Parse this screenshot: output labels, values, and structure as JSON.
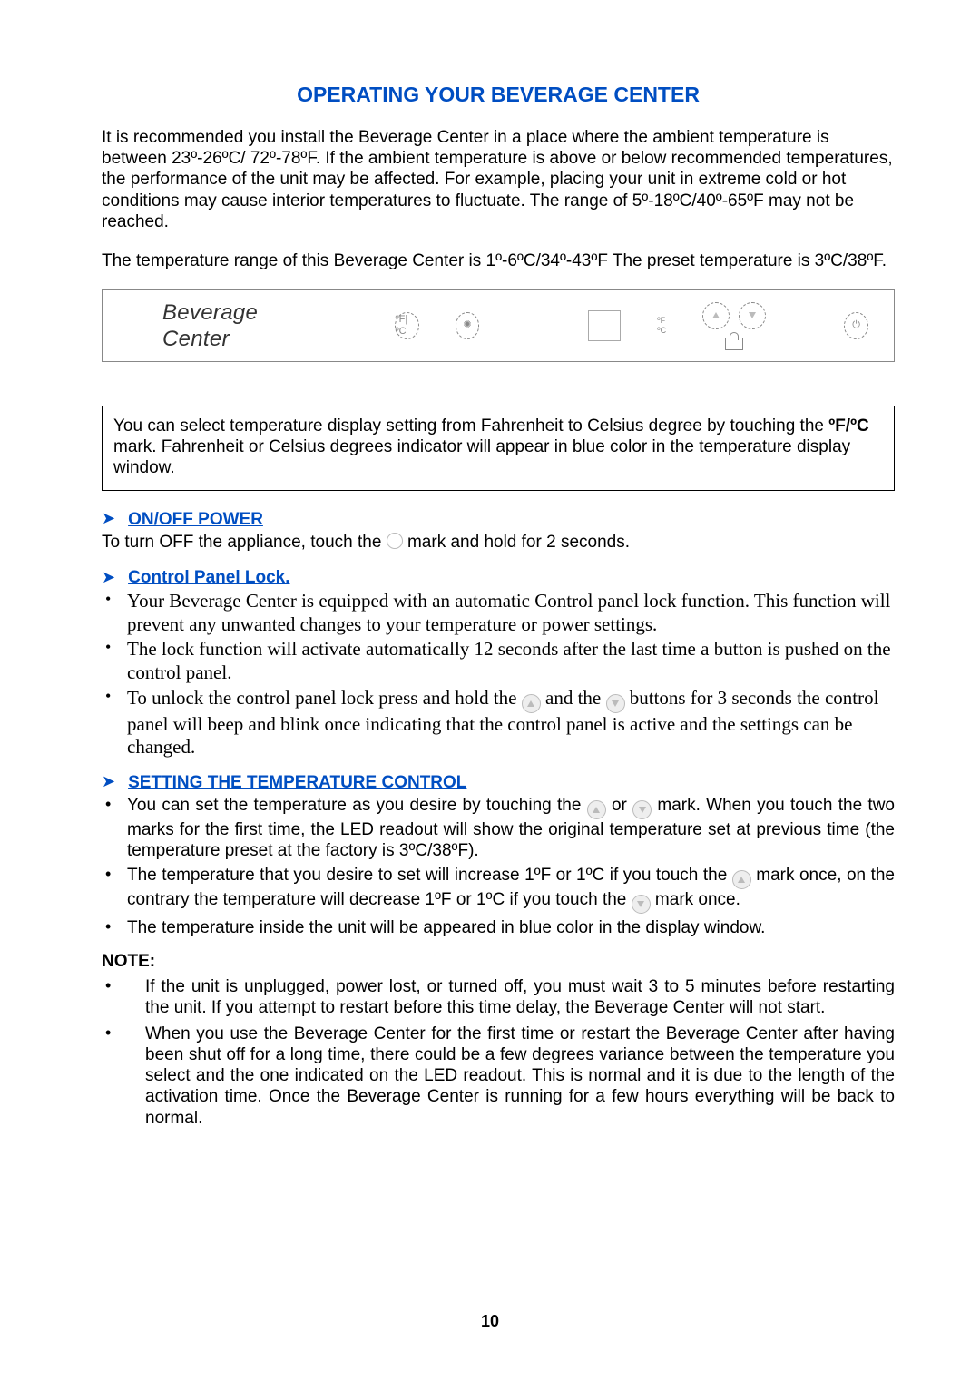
{
  "title": "OPERATING YOUR BEVERAGE CENTER",
  "intro1": "It is recommended you install the Beverage Center in a place where the ambient temperature is between 23º-26ºC/ 72º-78ºF.  If the ambient temperature is above or below recommended temperatures, the performance of the unit may be affected.  For example, placing your unit in extreme cold or hot conditions may cause interior temperatures to fluctuate.  The range of 5º-18ºC/40º-65ºF may not be reached.",
  "intro2": "The temperature range of this Beverage Center is 1º-6ºC/34º-43ºF The preset temperature is 3ºC/38ºF.",
  "panel": {
    "label": "Beverage Center",
    "fc_icon": "ºF|ºC",
    "light_icon": "✺",
    "deg_f": "ºF",
    "deg_c": "ºC"
  },
  "note_box_a": "You can select temperature display setting from Fahrenheit to Celsius degree by touching the ",
  "note_box_bold": "ºF/ºC",
  "note_box_b": " mark.  Fahrenheit or Celsius degrees indicator will appear in blue color in the temperature display window.",
  "sec_power": "ON/OFF POWER",
  "power_a": "To turn OFF the appliance, touch the  ",
  "power_b": "  mark and hold  for 2 seconds.",
  "sec_lock": "Control Panel Lock.",
  "lock_b1": "Your Beverage Center is equipped with an automatic Control panel lock function.  This function will prevent any unwanted changes to your temperature or power settings.",
  "lock_b2": "The lock function will activate automatically 12 seconds after the last time a button is pushed on the control panel.",
  "lock_b3a": "To unlock the control panel lock press and hold the ",
  "lock_b3b": " and the ",
  "lock_b3c": " buttons for 3 seconds the control panel will beep and blink once indicating that the control panel is active and the settings can be changed.",
  "sec_temp": "SETTING THE TEMPERATURE CONTROL",
  "temp_b1a": "You can set the temperature as you desire by touching the ",
  "temp_b1b": " or ",
  "temp_b1c": " mark. When you touch the two marks for the first time, the LED readout will show the original temperature set at previous time (the temperature preset at the factory is 3ºC/38ºF).",
  "temp_b2a": "The temperature that you desire to set will increase 1ºF or 1ºC if you touch the ",
  "temp_b2b": " mark once, on the contrary the temperature will decrease 1ºF or 1ºC if you touch the  ",
  "temp_b2c": " mark once.",
  "temp_b3": "The temperature inside the unit will be appeared in blue color in the display window.",
  "note_head": "NOTE:",
  "note_b1": "If the unit is unplugged, power lost, or turned off, you must wait 3 to 5 minutes before restarting the unit. If you attempt to restart before this time delay, the Beverage Center will not start.",
  "note_b2": "When you use the Beverage Center for the first time or restart the Beverage Center after having been shut off for a long time, there could be a few degrees variance between the temperature you select and the one indicated on the LED readout.  This is normal and it is due to the length of the activation time. Once the Beverage Center is running for a few hours everything will be back to normal.",
  "page_number": "10"
}
